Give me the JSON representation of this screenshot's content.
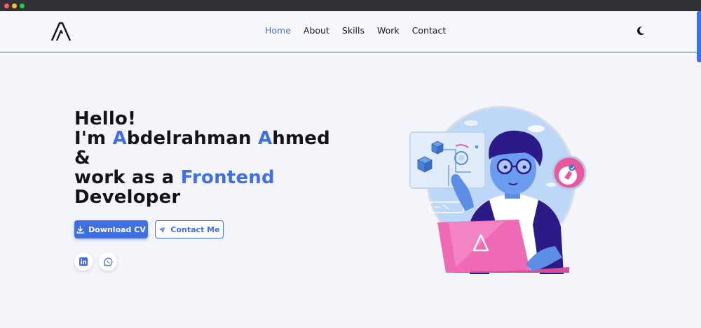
{
  "colors": {
    "accent": "#3f6fe0",
    "text": "#121418",
    "background": "#f4f5fb"
  },
  "nav": {
    "logo_icon": "logo-a-icon",
    "items": [
      {
        "label": "Home",
        "active": true
      },
      {
        "label": "About",
        "active": false
      },
      {
        "label": "Skills",
        "active": false
      },
      {
        "label": "Work",
        "active": false
      },
      {
        "label": "Contact",
        "active": false
      }
    ],
    "theme_icon": "moon-icon"
  },
  "hero": {
    "hello": "Hello!",
    "im": "I'm ",
    "first_initial": "A",
    "first_rest": "bdelrahman ",
    "last_initial": "A",
    "last_rest": "hmed",
    "amp": "&",
    "work_prefix": "work as a ",
    "role_word1": "Frontend",
    "role_word2": "Developer"
  },
  "buttons": {
    "download_cv": "Download CV",
    "download_icon": "download-icon",
    "contact_me": "Contact Me",
    "contact_icon": "send-icon"
  },
  "social": [
    {
      "icon": "linkedin-icon"
    },
    {
      "icon": "whatsapp-icon"
    }
  ],
  "illustration": {
    "icon": "developer-illustration"
  }
}
